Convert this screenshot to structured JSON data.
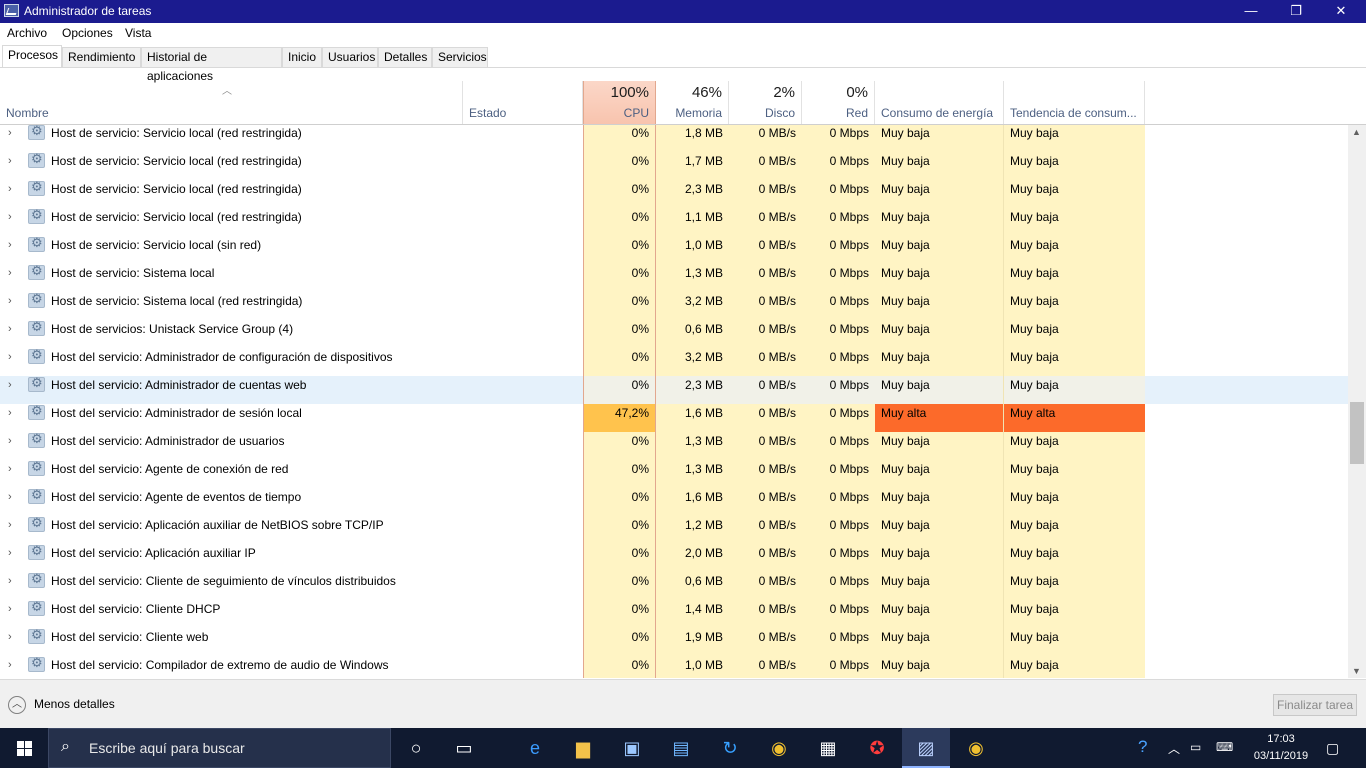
{
  "window": {
    "title": "Administrador de tareas",
    "minimize": "—",
    "maximize": "❐",
    "close": "✕"
  },
  "menu": [
    "Archivo",
    "Opciones",
    "Vista"
  ],
  "tabs": [
    "Procesos",
    "Rendimiento",
    "Historial de aplicaciones",
    "Inicio",
    "Usuarios",
    "Detalles",
    "Servicios"
  ],
  "header": {
    "name": "Nombre",
    "status": "Estado",
    "cpu": {
      "pct": "100%",
      "label": "CPU"
    },
    "memory": {
      "pct": "46%",
      "label": "Memoria"
    },
    "disk": {
      "pct": "2%",
      "label": "Disco"
    },
    "network": {
      "pct": "0%",
      "label": "Red"
    },
    "power": "Consumo de energía",
    "power_trend": "Tendencia de consum..."
  },
  "rows": [
    {
      "name": "Host de servicio: Servicio local (red restringida)",
      "cpu": "0%",
      "mem": "1,8 MB",
      "disk": "0 MB/s",
      "net": "0 Mbps",
      "power": "Muy baja",
      "trend": "Muy baja"
    },
    {
      "name": "Host de servicio: Servicio local (red restringida)",
      "cpu": "0%",
      "mem": "1,7 MB",
      "disk": "0 MB/s",
      "net": "0 Mbps",
      "power": "Muy baja",
      "trend": "Muy baja"
    },
    {
      "name": "Host de servicio: Servicio local (red restringida)",
      "cpu": "0%",
      "mem": "2,3 MB",
      "disk": "0 MB/s",
      "net": "0 Mbps",
      "power": "Muy baja",
      "trend": "Muy baja"
    },
    {
      "name": "Host de servicio: Servicio local (red restringida)",
      "cpu": "0%",
      "mem": "1,1 MB",
      "disk": "0 MB/s",
      "net": "0 Mbps",
      "power": "Muy baja",
      "trend": "Muy baja"
    },
    {
      "name": "Host de servicio: Servicio local (sin red)",
      "cpu": "0%",
      "mem": "1,0 MB",
      "disk": "0 MB/s",
      "net": "0 Mbps",
      "power": "Muy baja",
      "trend": "Muy baja"
    },
    {
      "name": "Host de servicio: Sistema local",
      "cpu": "0%",
      "mem": "1,3 MB",
      "disk": "0 MB/s",
      "net": "0 Mbps",
      "power": "Muy baja",
      "trend": "Muy baja"
    },
    {
      "name": "Host de servicio: Sistema local (red restringida)",
      "cpu": "0%",
      "mem": "3,2 MB",
      "disk": "0 MB/s",
      "net": "0 Mbps",
      "power": "Muy baja",
      "trend": "Muy baja"
    },
    {
      "name": "Host de servicios: Unistack Service Group (4)",
      "cpu": "0%",
      "mem": "0,6 MB",
      "disk": "0 MB/s",
      "net": "0 Mbps",
      "power": "Muy baja",
      "trend": "Muy baja"
    },
    {
      "name": "Host del servicio: Administrador de configuración de dispositivos",
      "cpu": "0%",
      "mem": "3,2 MB",
      "disk": "0 MB/s",
      "net": "0 Mbps",
      "power": "Muy baja",
      "trend": "Muy baja"
    },
    {
      "name": "Host del servicio: Administrador de cuentas web",
      "cpu": "0%",
      "mem": "2,3 MB",
      "disk": "0 MB/s",
      "net": "0 Mbps",
      "power": "Muy baja",
      "trend": "Muy baja"
    },
    {
      "name": "Host del servicio: Administrador de sesión local",
      "cpu": "47,2%",
      "mem": "1,6 MB",
      "disk": "0 MB/s",
      "net": "0 Mbps",
      "power": "Muy alta",
      "trend": "Muy alta"
    },
    {
      "name": "Host del servicio: Administrador de usuarios",
      "cpu": "0%",
      "mem": "1,3 MB",
      "disk": "0 MB/s",
      "net": "0 Mbps",
      "power": "Muy baja",
      "trend": "Muy baja"
    },
    {
      "name": "Host del servicio: Agente de conexión de red",
      "cpu": "0%",
      "mem": "1,3 MB",
      "disk": "0 MB/s",
      "net": "0 Mbps",
      "power": "Muy baja",
      "trend": "Muy baja"
    },
    {
      "name": "Host del servicio: Agente de eventos de tiempo",
      "cpu": "0%",
      "mem": "1,6 MB",
      "disk": "0 MB/s",
      "net": "0 Mbps",
      "power": "Muy baja",
      "trend": "Muy baja"
    },
    {
      "name": "Host del servicio: Aplicación auxiliar de NetBIOS sobre TCP/IP",
      "cpu": "0%",
      "mem": "1,2 MB",
      "disk": "0 MB/s",
      "net": "0 Mbps",
      "power": "Muy baja",
      "trend": "Muy baja"
    },
    {
      "name": "Host del servicio: Aplicación auxiliar IP",
      "cpu": "0%",
      "mem": "2,0 MB",
      "disk": "0 MB/s",
      "net": "0 Mbps",
      "power": "Muy baja",
      "trend": "Muy baja"
    },
    {
      "name": "Host del servicio: Cliente de seguimiento de vínculos distribuidos",
      "cpu": "0%",
      "mem": "0,6 MB",
      "disk": "0 MB/s",
      "net": "0 Mbps",
      "power": "Muy baja",
      "trend": "Muy baja"
    },
    {
      "name": "Host del servicio: Cliente DHCP",
      "cpu": "0%",
      "mem": "1,4 MB",
      "disk": "0 MB/s",
      "net": "0 Mbps",
      "power": "Muy baja",
      "trend": "Muy baja"
    },
    {
      "name": "Host del servicio: Cliente web",
      "cpu": "0%",
      "mem": "1,9 MB",
      "disk": "0 MB/s",
      "net": "0 Mbps",
      "power": "Muy baja",
      "trend": "Muy baja"
    },
    {
      "name": "Host del servicio: Compilador de extremo de audio de Windows",
      "cpu": "0%",
      "mem": "1,0 MB",
      "disk": "0 MB/s",
      "net": "0 Mbps",
      "power": "Muy baja",
      "trend": "Muy baja"
    }
  ],
  "highlighted_row": "Host del servicio: Administrador de cuentas web",
  "hot_row": "Host del servicio: Administrador de sesión local",
  "footer": {
    "less_details": "Menos detalles",
    "end_task": "Finalizar tarea"
  },
  "taskbar": {
    "search_placeholder": "Escribe aquí para buscar",
    "time": "17:03",
    "date": "03/11/2019"
  },
  "colors": {
    "title_bar": "#1b1b8f",
    "cpu_hot": "#ffc34d",
    "power_hot": "#fc6a2a",
    "column_heat": "#fff4c4"
  }
}
